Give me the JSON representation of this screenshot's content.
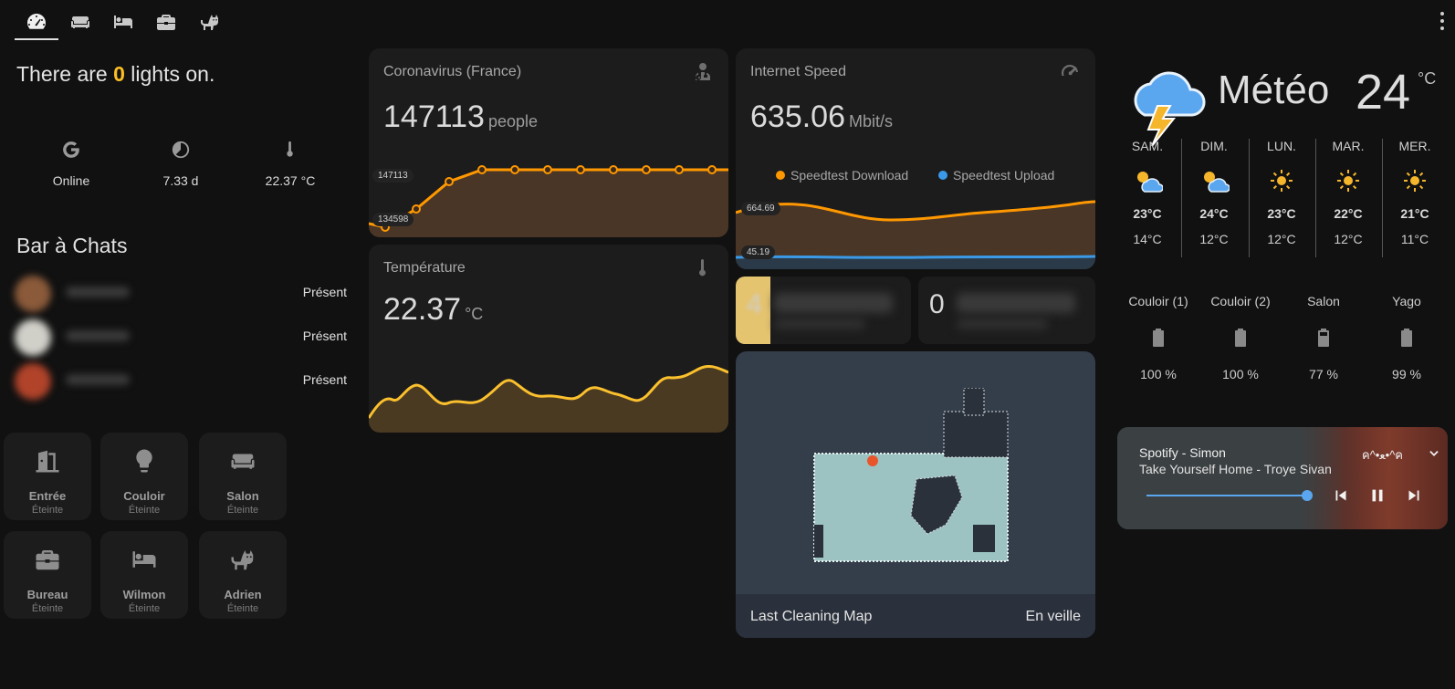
{
  "header": {
    "tabs": [
      {
        "name": "tab-dashboard",
        "icon": "gauge-icon"
      },
      {
        "name": "tab-living",
        "icon": "sofa-icon"
      },
      {
        "name": "tab-bedroom",
        "icon": "bed-icon"
      },
      {
        "name": "tab-office",
        "icon": "briefcase-icon"
      },
      {
        "name": "tab-cat",
        "icon": "cat-icon"
      }
    ]
  },
  "lights": {
    "prefix": "There are ",
    "count": "0",
    "suffix": " lights on."
  },
  "status_stats": [
    {
      "icon": "google-icon",
      "value": "Online"
    },
    {
      "icon": "uptime-icon",
      "value": "7.33 d"
    },
    {
      "icon": "thermometer-icon",
      "value": "22.37 °C"
    }
  ],
  "bar_chats": {
    "title": "Bar à Chats",
    "people": [
      {
        "status": "Présent",
        "color": "#8a5a3a"
      },
      {
        "status": "Présent",
        "color": "#d0cfc8"
      },
      {
        "status": "Présent",
        "color": "#b0432a"
      }
    ]
  },
  "rooms": [
    {
      "name": "Entrée",
      "state": "Éteinte",
      "icon": "door-icon"
    },
    {
      "name": "Couloir",
      "state": "Éteinte",
      "icon": "lightbulb-icon"
    },
    {
      "name": "Salon",
      "state": "Éteinte",
      "icon": "sofa-icon"
    },
    {
      "name": "Bureau",
      "state": "Éteinte",
      "icon": "briefcase-icon"
    },
    {
      "name": "Wilmon",
      "state": "Éteinte",
      "icon": "bed-icon"
    },
    {
      "name": "Adrien",
      "state": "Éteinte",
      "icon": "cat-icon"
    }
  ],
  "covid": {
    "title": "Coronavirus (France)",
    "value": "147113",
    "unit": "people",
    "max_label": "147113",
    "min_label": "134598"
  },
  "temperature": {
    "title": "Température",
    "value": "22.37",
    "unit": "°C"
  },
  "internet": {
    "title": "Internet Speed",
    "value": "635.06",
    "unit": "Mbit/s",
    "legend_download": "Speedtest Download",
    "legend_upload": "Speedtest Upload",
    "max_label": "664.69",
    "min_label": "45.19",
    "download_color": "#ff9800",
    "upload_color": "#3a9ae8"
  },
  "mini_cards": [
    {
      "value": "4",
      "accent": "#e5c46f"
    },
    {
      "value": "0",
      "accent": "#1c1c1c"
    }
  ],
  "vacuum": {
    "label": "Last Cleaning Map",
    "state": "En veille"
  },
  "weather": {
    "name": "Météo",
    "temp": "24",
    "unit": "°C",
    "forecast": [
      {
        "day": "SAM.",
        "hi": "23°C",
        "lo": "14°C",
        "icon": "partly-cloudy-icon"
      },
      {
        "day": "DIM.",
        "hi": "24°C",
        "lo": "12°C",
        "icon": "partly-cloudy-icon"
      },
      {
        "day": "LUN.",
        "hi": "23°C",
        "lo": "12°C",
        "icon": "sun-icon"
      },
      {
        "day": "MAR.",
        "hi": "22°C",
        "lo": "12°C",
        "icon": "sun-icon"
      },
      {
        "day": "MER.",
        "hi": "21°C",
        "lo": "11°C",
        "icon": "sun-icon"
      }
    ]
  },
  "batteries": [
    {
      "name": "Couloir (1)",
      "value": "100 %"
    },
    {
      "name": "Couloir (2)",
      "value": "100 %"
    },
    {
      "name": "Salon",
      "value": "77 %"
    },
    {
      "name": "Yago",
      "value": "99 %"
    }
  ],
  "media": {
    "source": "Spotify - Simon",
    "track": "Take Yourself Home - Troye Sivan",
    "device": "ค^•ﻌ•^ค",
    "progress": 0.95
  },
  "colors": {
    "accent_orange": "#ff9800",
    "accent_yellow": "#fbc02d",
    "lights_count": "#fbbf24"
  }
}
